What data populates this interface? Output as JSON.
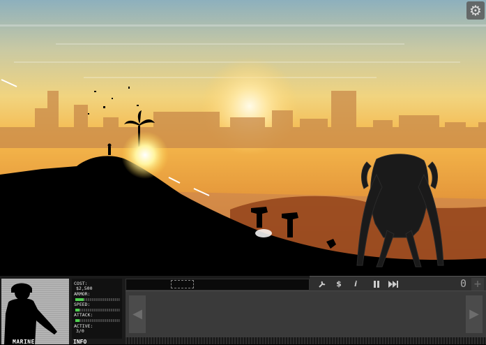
{
  "settings": {
    "icon": "gear-icon"
  },
  "unit": {
    "name": "MARINE",
    "info_label": "INFO",
    "cost_label": "COST:",
    "cost_value": "$2,500",
    "armor_label": "ARMOR:",
    "armor_level": 0.18,
    "speed_label": "SPEED:",
    "speed_level": 0.1,
    "attack_label": "ATTACK:",
    "attack_level": 0.1,
    "active_label": "ACTIVE:",
    "active_value": "3/0"
  },
  "toolbar": {
    "icons": [
      "wrench-icon",
      "dollar-icon",
      "info-icon",
      "pause-icon",
      "fast-forward-icon"
    ],
    "dollar_label": "$",
    "info_label": "i",
    "counter": "0",
    "plus_label": "+"
  },
  "colors": {
    "sky_top": "#8fb3bd",
    "sky_glow": "#f4c44e",
    "hud_bg": "#1b1b1b",
    "stat_fill": "#4ed04e"
  }
}
